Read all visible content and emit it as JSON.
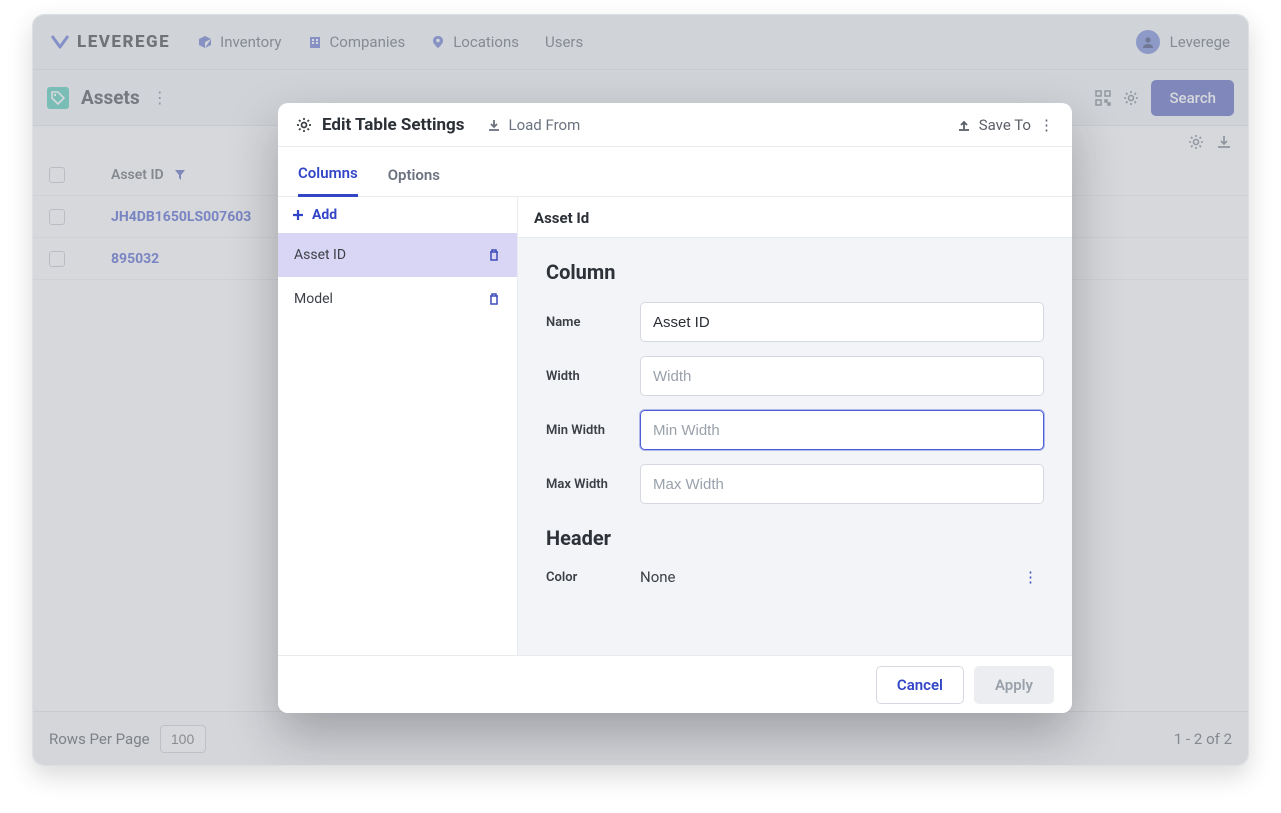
{
  "brand": {
    "name": "LEVEREGE"
  },
  "nav": {
    "inventory": "Inventory",
    "companies": "Companies",
    "locations": "Locations",
    "users": "Users"
  },
  "user": {
    "name": "Leverege"
  },
  "assets": {
    "title": "Assets",
    "search_label": "Search",
    "column_header": "Asset ID",
    "rows": [
      {
        "id": "JH4DB1650LS007603"
      },
      {
        "id": "895032"
      }
    ]
  },
  "footer": {
    "rows_per_page_label": "Rows Per Page",
    "rows_per_page_value": "100",
    "page_info": "1 - 2 of 2"
  },
  "modal": {
    "title": "Edit Table Settings",
    "load_from": "Load From",
    "save_to": "Save To",
    "tabs": {
      "columns": "Columns",
      "options": "Options"
    },
    "sidebar": {
      "add": "Add",
      "items": [
        {
          "label": "Asset ID",
          "active": true
        },
        {
          "label": "Model",
          "active": false
        }
      ]
    },
    "content": {
      "title": "Asset Id",
      "section_column": "Column",
      "fields": {
        "name_label": "Name",
        "name_value": "Asset ID",
        "width_label": "Width",
        "width_placeholder": "Width",
        "minwidth_label": "Min Width",
        "minwidth_placeholder": "Min Width",
        "maxwidth_label": "Max Width",
        "maxwidth_placeholder": "Max Width"
      },
      "section_header": "Header",
      "color_label": "Color",
      "color_value": "None"
    },
    "footer": {
      "cancel": "Cancel",
      "apply": "Apply"
    }
  }
}
